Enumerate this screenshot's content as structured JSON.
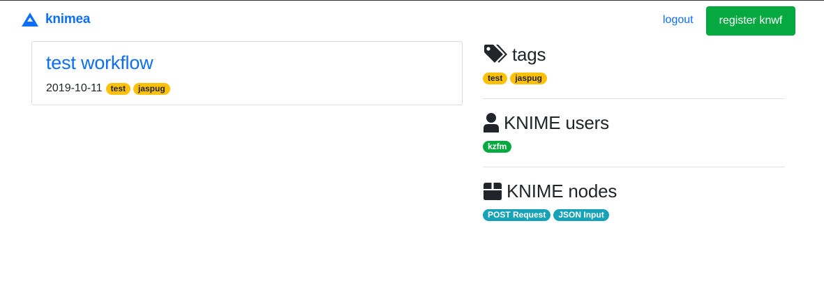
{
  "brand": {
    "label": "knimea",
    "color": "#0d6efd"
  },
  "nav": {
    "logout_label": "logout",
    "register_label": "register knwf",
    "register_color": "#06a840"
  },
  "workflow": {
    "title": "test workflow",
    "date": "2019-10-11",
    "tags": [
      "test",
      "jaspug"
    ]
  },
  "sidebar": {
    "tags": {
      "title": "tags",
      "icon": "tags-icon",
      "items": [
        "test",
        "jaspug"
      ],
      "badge_color": "#ffc107"
    },
    "users": {
      "title": "KNIME users",
      "icon": "user-icon",
      "items": [
        "kzfm"
      ],
      "badge_color": "#06a840"
    },
    "nodes": {
      "title": "KNIME nodes",
      "icon": "box-icon",
      "items": [
        "POST Request",
        "JSON Input"
      ],
      "badge_color": "#17a2b8"
    }
  }
}
